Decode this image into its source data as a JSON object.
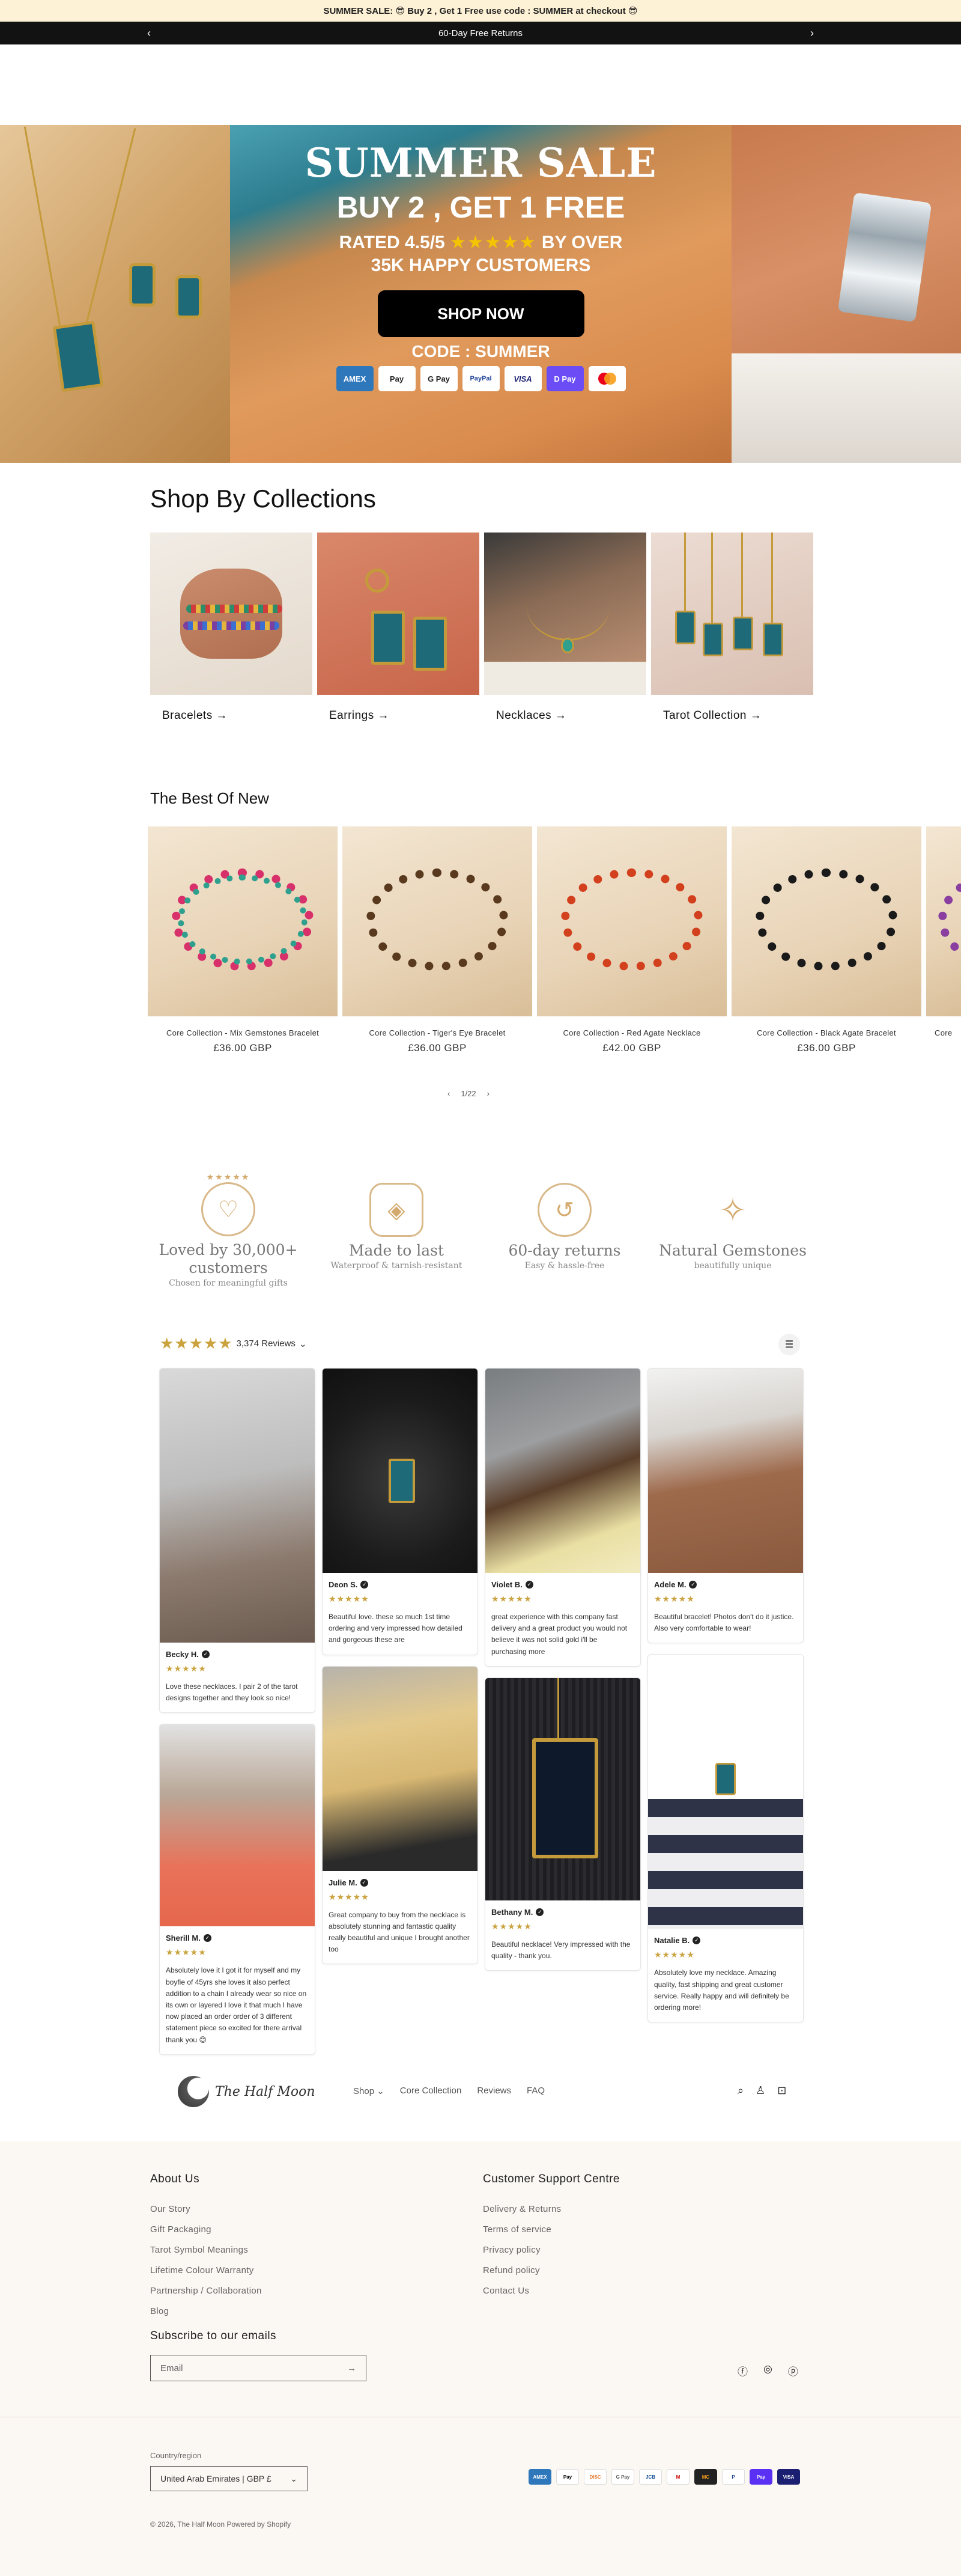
{
  "announcement": {
    "promo": "SUMMER SALE: 😎 Buy 2 , Get 1 Free use code : SUMMER at checkout 😎",
    "notice": "60-Day Free Returns",
    "prev_icon": "chevron-left-icon",
    "next_icon": "chevron-right-icon"
  },
  "hero": {
    "title": "SUMMER SALE",
    "offer": "BUY 2 , GET 1 FREE",
    "rating_prefix": "RATED 4.5/5",
    "rating_stars": "★★★★★",
    "rating_suffix": "BY OVER",
    "customers": "35K HAPPY CUSTOMERS",
    "cta": "SHOP NOW",
    "code": "CODE : SUMMER",
    "payments": [
      "AMEX",
      "Pay",
      "G Pay",
      "PayPal",
      "VISA",
      "D Pay",
      "MC"
    ]
  },
  "collections": {
    "title": "Shop By Collections",
    "items": [
      {
        "label": "Bracelets →"
      },
      {
        "label": "Earrings →"
      },
      {
        "label": "Necklaces →"
      },
      {
        "label": "Tarot Collection →"
      }
    ]
  },
  "best_new": {
    "title": "The Best Of New",
    "products": [
      {
        "name": "Core Collection - Mix Gemstones Bracelet",
        "price": "£36.00 GBP"
      },
      {
        "name": "Core Collection - Tiger's Eye Bracelet",
        "price": "£36.00 GBP"
      },
      {
        "name": "Core Collection - Red Agate Necklace",
        "price": "£42.00 GBP"
      },
      {
        "name": "Core Collection - Black Agate Bracelet",
        "price": "£36.00 GBP"
      },
      {
        "name": "Core",
        "price": ""
      }
    ],
    "pager": "1/22",
    "prev": "‹",
    "next": "›"
  },
  "features": [
    {
      "stars": "★★★★★",
      "title": "Loved by 30,000+ customers",
      "subtitle": "Chosen for meaningful gifts",
      "icon": "user-heart-icon"
    },
    {
      "stars": "",
      "title": "Made to last",
      "subtitle": "Waterproof & tarnish-resistant",
      "icon": "water-drop-shield-icon"
    },
    {
      "stars": "",
      "title": "60-day returns",
      "subtitle": "Easy & hassle-free",
      "icon": "return-box-icon"
    },
    {
      "stars": "",
      "title": "Natural Gemstones",
      "subtitle": "beautifully unique",
      "icon": "gem-crystal-icon"
    }
  ],
  "reviews": {
    "stars": "★★★★★",
    "count": "3,374 Reviews",
    "items": [
      {
        "name": "Becky H.",
        "stars": "★★★★★",
        "text": "Love these necklaces. I pair 2 of the tarot designs together and they look so nice!"
      },
      {
        "name": "Sherill M.",
        "stars": "★★★★★",
        "text": "Absolutely love it I got it for myself and my boyfie of 45yrs she loves it also perfect addition to a chain I already wear so nice on its own or layered I love it that much I have now placed an order order of 3 different statement piece so excited for there arrival thank you 😊"
      },
      {
        "name": "Deon S.",
        "stars": "★★★★★",
        "text": "Beautiful love. these so much 1st time ordering and very impressed how detailed and gorgeous these are"
      },
      {
        "name": "Julie M.",
        "stars": "★★★★★",
        "text": "Great company to buy from the necklace is absolutely stunning and fantastic quality really beautiful and unique I brought another too"
      },
      {
        "name": "Violet B.",
        "stars": "★★★★★",
        "text": "great experience with this company fast delivery and a great product you would not believe it was not solid gold i'll be purchasing more"
      },
      {
        "name": "Bethany M.",
        "stars": "★★★★★",
        "text": "Beautiful necklace! Very impressed with the quality - thank you."
      },
      {
        "name": "Adele M.",
        "stars": "★★★★★",
        "text": "Beautiful bracelet! Photos don't do it justice. Also very comfortable to wear!"
      },
      {
        "name": "Natalie B.",
        "stars": "★★★★★",
        "text": "Absolutely love my necklace. Amazing quality, fast shipping and great customer service. Really happy and will definitely be ordering more!"
      }
    ]
  },
  "header": {
    "logo": "The Half Moon",
    "nav": [
      "Shop ⌄",
      "Core Collection",
      "Reviews",
      "FAQ"
    ]
  },
  "footer": {
    "about_title": "About Us",
    "about_links": [
      "Our Story",
      "Gift Packaging",
      "Tarot Symbol Meanings",
      "Lifetime Colour Warranty",
      "Partnership / Collaboration",
      "Blog"
    ],
    "support_title": "Customer Support Centre",
    "support_links": [
      "Delivery & Returns",
      "Terms of service",
      "Privacy policy",
      "Refund policy",
      "Contact Us"
    ],
    "subscribe_title": "Subscribe to our emails",
    "email_placeholder": "Email",
    "country_label": "Country/region",
    "country_value": "United Arab Emirates | GBP £",
    "payments": [
      "AMEX",
      "Pay",
      "DISC",
      "G Pay",
      "JCB",
      "M",
      "MC",
      "P",
      "Pay",
      "VISA"
    ],
    "copyright": "© 2026, The Half Moon Powered by Shopify"
  }
}
